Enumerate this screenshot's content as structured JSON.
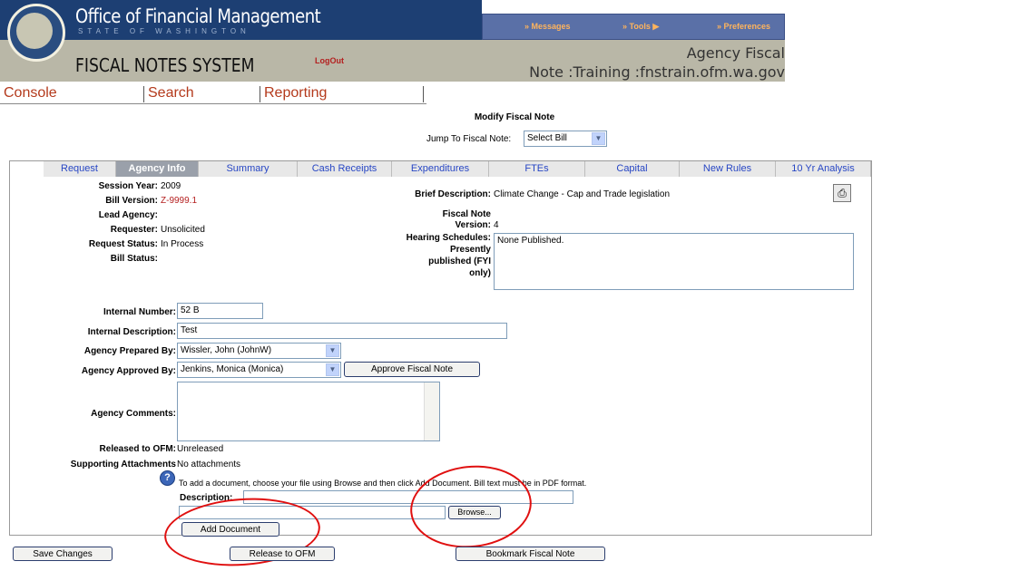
{
  "header": {
    "org_title": "Office of Financial Management",
    "org_subtitle": "STATE OF WASHINGTON",
    "system_title": "FISCAL NOTES SYSTEM",
    "logout_label": "LogOut",
    "agency_title_line1": "Agency Fiscal",
    "agency_title_line2": "Note :Training :fnstrain.ofm.wa.gov",
    "menu": {
      "messages_label": "» Messages",
      "tools_label": "» Tools ▶",
      "preferences_label": "» Preferences"
    },
    "colors": {
      "banner": "#1d3f73",
      "band": "#b9b7a7",
      "accent": "#b41f1f"
    }
  },
  "nav": {
    "console": "Console",
    "search": "Search",
    "reporting": "Reporting"
  },
  "page": {
    "title": "Modify Fiscal Note",
    "jump_label": "Jump To Fiscal Note:",
    "jump_value": "Select Bill"
  },
  "tabs": [
    "Request",
    "Agency Info",
    "Summary",
    "Cash Receipts",
    "Expenditures",
    "FTEs",
    "Capital",
    "New Rules",
    "10 Yr Analysis"
  ],
  "active_tab": "Agency Info",
  "info": {
    "session_year_label": "Session Year:",
    "session_year": "2009",
    "bill_version_label": "Bill Version:",
    "bill_version": "Z-9999.1",
    "lead_agency_label": "Lead Agency:",
    "lead_agency": "",
    "requester_label": "Requester:",
    "requester": "Unsolicited",
    "request_status_label": "Request Status:",
    "request_status": "In Process",
    "bill_status_label": "Bill Status:",
    "bill_status": "",
    "brief_desc_label": "Brief Description:",
    "brief_desc": "Climate Change - Cap and Trade legislation",
    "fn_version_label_1": "Fiscal Note",
    "fn_version_label_2": "Version:",
    "fn_version": "4",
    "hearing_label_1": "Hearing Schedules:",
    "hearing_label_2": "Presently",
    "hearing_label_3": "published (FYI",
    "hearing_label_4": "only)",
    "hearing_value": "None Published."
  },
  "form": {
    "internal_number_label": "Internal Number:",
    "internal_number": "52 B",
    "internal_desc_label": "Internal Description:",
    "internal_desc": "Test",
    "prepared_by_label": "Agency Prepared By:",
    "prepared_by": "Wissler, John (JohnW)",
    "approved_by_label": "Agency Approved By:",
    "approved_by": "Jenkins, Monica (Monica)",
    "approve_button": "Approve Fiscal Note",
    "comments_label": "Agency Comments:",
    "comments": "",
    "released_label": "Released to OFM:",
    "released": "Unreleased",
    "attachments_label": "Supporting Attachments",
    "attachments": "No attachments",
    "help_text": "To add a document, choose your file using Browse and then click Add Document. Bill text must be in PDF format.",
    "description_label": "Description:",
    "description": "",
    "file_value": "",
    "browse_button": "Browse...",
    "add_document_button": "Add Document"
  },
  "footer": {
    "save_button": "Save Changes",
    "release_button": "Release to OFM",
    "bookmark_button": "Bookmark Fiscal Note"
  }
}
